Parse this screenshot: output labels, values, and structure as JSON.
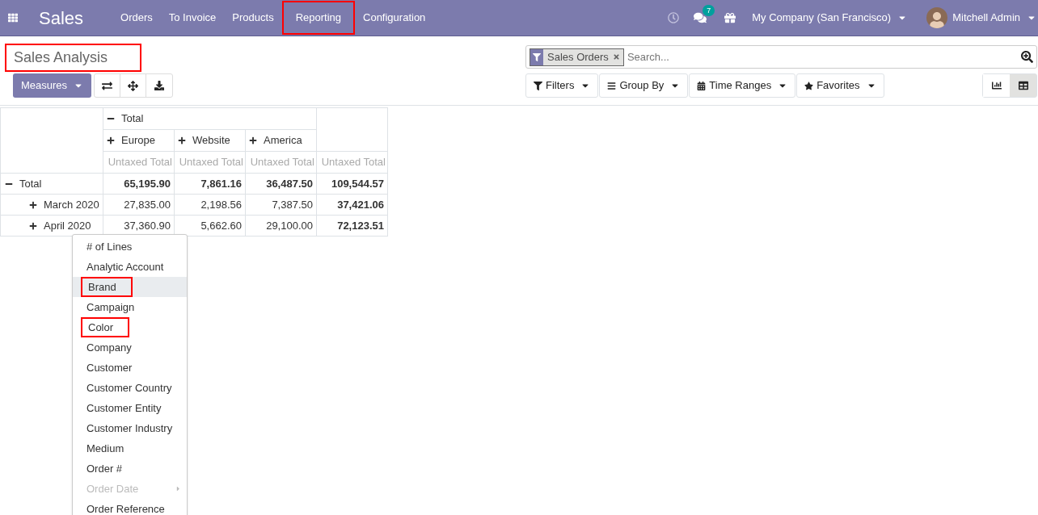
{
  "navbar": {
    "app_title": "Sales",
    "menu": [
      {
        "label": "Orders",
        "annotated": false
      },
      {
        "label": "To Invoice",
        "annotated": false
      },
      {
        "label": "Products",
        "annotated": false
      },
      {
        "label": "Reporting",
        "annotated": true
      },
      {
        "label": "Configuration",
        "annotated": false
      }
    ],
    "messages_badge": "7",
    "company": "My Company (San Francisco)",
    "user": "Mitchell Admin"
  },
  "page_title": {
    "text": "Sales Analysis",
    "annotated": true
  },
  "toolbar": {
    "measures_button": "Measures"
  },
  "search": {
    "facet": "Sales Orders",
    "placeholder": "Search..."
  },
  "filter_buttons": [
    {
      "kind": "filter",
      "label": "Filters"
    },
    {
      "kind": "groupby",
      "label": "Group By"
    },
    {
      "kind": "time",
      "label": "Time Ranges"
    },
    {
      "kind": "favorites",
      "label": "Favorites"
    }
  ],
  "views": [
    {
      "kind": "graph",
      "selected": false
    },
    {
      "kind": "pivot",
      "selected": true
    }
  ],
  "pivot": {
    "header_total": "Total",
    "columns": [
      "Europe",
      "Website",
      "America"
    ],
    "measures": [
      "Untaxed Total",
      "Untaxed Total",
      "Untaxed Total",
      "Untaxed Total"
    ],
    "rows": [
      {
        "label": "Total",
        "expanded": true,
        "values": [
          "65,195.90",
          "7,861.16",
          "36,487.50",
          "109,544.57"
        ]
      },
      {
        "label": "March 2020",
        "expanded": false,
        "values": [
          "27,835.00",
          "2,198.56",
          "7,387.50",
          "37,421.06"
        ]
      },
      {
        "label": "April 2020",
        "expanded": false,
        "values": [
          "37,360.90",
          "5,662.60",
          "29,100.00",
          "72,123.51"
        ]
      }
    ]
  },
  "dropdown": [
    {
      "label": "# of Lines",
      "selected": false,
      "disabled": false,
      "annotated": false
    },
    {
      "label": "Analytic Account",
      "selected": false,
      "disabled": false,
      "annotated": false
    },
    {
      "label": "Brand",
      "selected": true,
      "disabled": false,
      "annotated": true
    },
    {
      "label": "Campaign",
      "selected": false,
      "disabled": false,
      "annotated": false
    },
    {
      "label": "Color",
      "selected": false,
      "disabled": false,
      "annotated": true
    },
    {
      "label": "Company",
      "selected": false,
      "disabled": false,
      "annotated": false
    },
    {
      "label": "Customer",
      "selected": false,
      "disabled": false,
      "annotated": false
    },
    {
      "label": "Customer Country",
      "selected": false,
      "disabled": false,
      "annotated": false
    },
    {
      "label": "Customer Entity",
      "selected": false,
      "disabled": false,
      "annotated": false
    },
    {
      "label": "Customer Industry",
      "selected": false,
      "disabled": false,
      "annotated": false
    },
    {
      "label": "Medium",
      "selected": false,
      "disabled": false,
      "annotated": false
    },
    {
      "label": "Order #",
      "selected": false,
      "disabled": false,
      "annotated": false
    },
    {
      "label": "Order Date",
      "selected": false,
      "disabled": true,
      "annotated": false
    },
    {
      "label": "Order Reference",
      "selected": false,
      "disabled": false,
      "annotated": false
    }
  ]
}
